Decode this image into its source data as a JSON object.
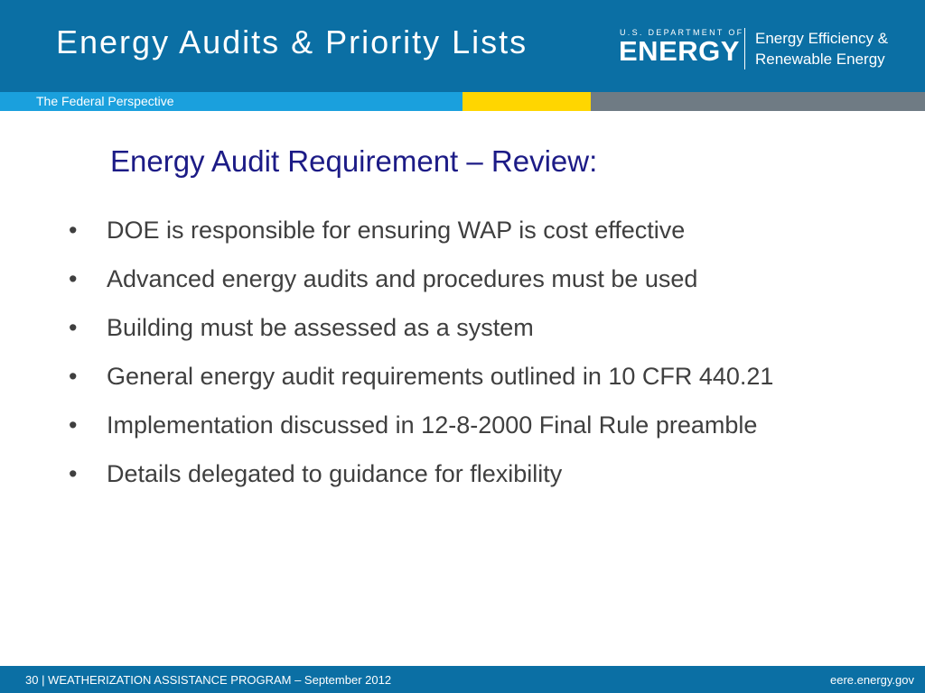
{
  "header": {
    "title": "Energy Audits & Priority Lists",
    "logo": {
      "small_text": "U.S. DEPARTMENT OF",
      "big_text": "ENERGY",
      "office_line1": "Energy Efficiency &",
      "office_line2": "Renewable Energy"
    },
    "subtitle": "The Federal Perspective"
  },
  "colors": {
    "header_blue": "#0b6fa4",
    "stripe_blue": "#1aa0dd",
    "stripe_yellow": "#ffd600",
    "stripe_gray": "#6f7b84",
    "heading_navy": "#1c1b86",
    "body_text": "#3f3f3f"
  },
  "body": {
    "heading": "Energy Audit Requirement – Review:",
    "bullet_symbol": "•",
    "bullets": [
      "DOE is responsible for ensuring WAP is cost effective",
      "Advanced energy audits and procedures must be used",
      "Building must be assessed as a system",
      "General energy audit requirements outlined in 10 CFR 440.21",
      "Implementation discussed in 12-8-2000 Final Rule preamble",
      "Details delegated to guidance for flexibility"
    ]
  },
  "footer": {
    "left_text": "30 | WEATHERIZATION ASSISTANCE PROGRAM   – September 2012",
    "right_text": "eere.energy.gov"
  }
}
